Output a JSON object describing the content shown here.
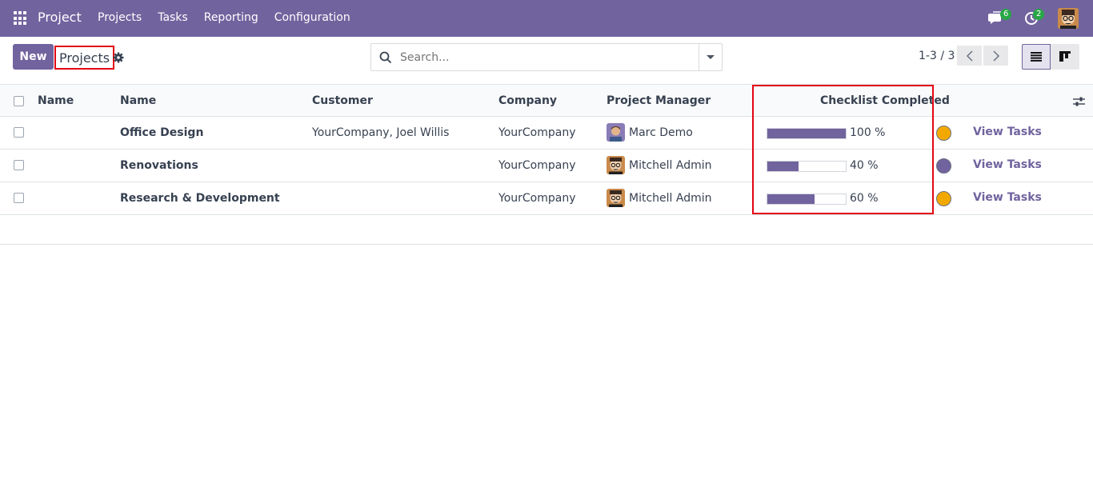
{
  "navbar": {
    "app_title": "Project",
    "menu": [
      "Projects",
      "Tasks",
      "Reporting",
      "Configuration"
    ],
    "messages_badge": "6",
    "activities_badge": "2"
  },
  "control": {
    "new_label": "New",
    "breadcrumb": "Projects",
    "search_placeholder": "Search...",
    "pager": "1-3 / 3"
  },
  "table": {
    "headers": {
      "name_1": "Name",
      "name_2": "Name",
      "customer": "Customer",
      "company": "Company",
      "manager": "Project Manager",
      "checklist": "Checklist Completed"
    },
    "rows": [
      {
        "name": "Office Design",
        "customer": "YourCompany, Joel Willis",
        "company": "YourCompany",
        "manager": "Marc Demo",
        "progress": 100,
        "progress_label": "100 %",
        "color": "#f3a800",
        "action": "View Tasks"
      },
      {
        "name": "Renovations",
        "customer": "",
        "company": "YourCompany",
        "manager": "Mitchell Admin",
        "progress": 40,
        "progress_label": "40 %",
        "color": "#71639e",
        "action": "View Tasks"
      },
      {
        "name": "Research & Development",
        "customer": "",
        "company": "YourCompany",
        "manager": "Mitchell Admin",
        "progress": 60,
        "progress_label": "60 %",
        "color": "#f3a800",
        "action": "View Tasks"
      }
    ]
  },
  "colors": {
    "brand": "#71639e",
    "highlight": "#e30613",
    "yellow": "#f3a800"
  }
}
